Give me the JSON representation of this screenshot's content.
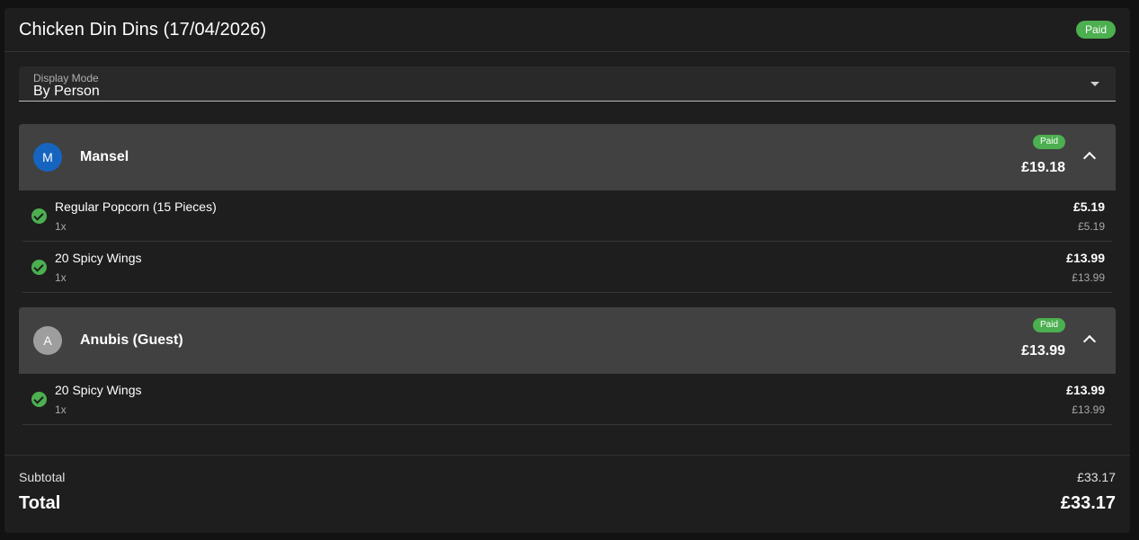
{
  "header": {
    "title": "Chicken Din Dins (17/04/2026)",
    "status": "Paid"
  },
  "display_mode": {
    "label": "Display Mode",
    "value": "By Person"
  },
  "people": [
    {
      "initial": "M",
      "name": "Mansel",
      "status": "Paid",
      "total": "£19.18",
      "avatar_color": "#1565c0",
      "items": [
        {
          "name": "Regular Popcorn (15 Pieces)",
          "qty": "1x",
          "price": "£5.19",
          "unit_price": "£5.19"
        },
        {
          "name": "20 Spicy Wings",
          "qty": "1x",
          "price": "£13.99",
          "unit_price": "£13.99"
        }
      ]
    },
    {
      "initial": "A",
      "name": "Anubis (Guest)",
      "status": "Paid",
      "total": "£13.99",
      "avatar_color": "#9e9e9e",
      "items": [
        {
          "name": "20 Spicy Wings",
          "qty": "1x",
          "price": "£13.99",
          "unit_price": "£13.99"
        }
      ]
    }
  ],
  "summary": {
    "subtotal_label": "Subtotal",
    "subtotal": "£33.17",
    "total_label": "Total",
    "total": "£33.17"
  },
  "colors": {
    "paid_green": "#4caf50",
    "card_bg": "#1e1e1e",
    "person_header_bg": "#414141"
  }
}
